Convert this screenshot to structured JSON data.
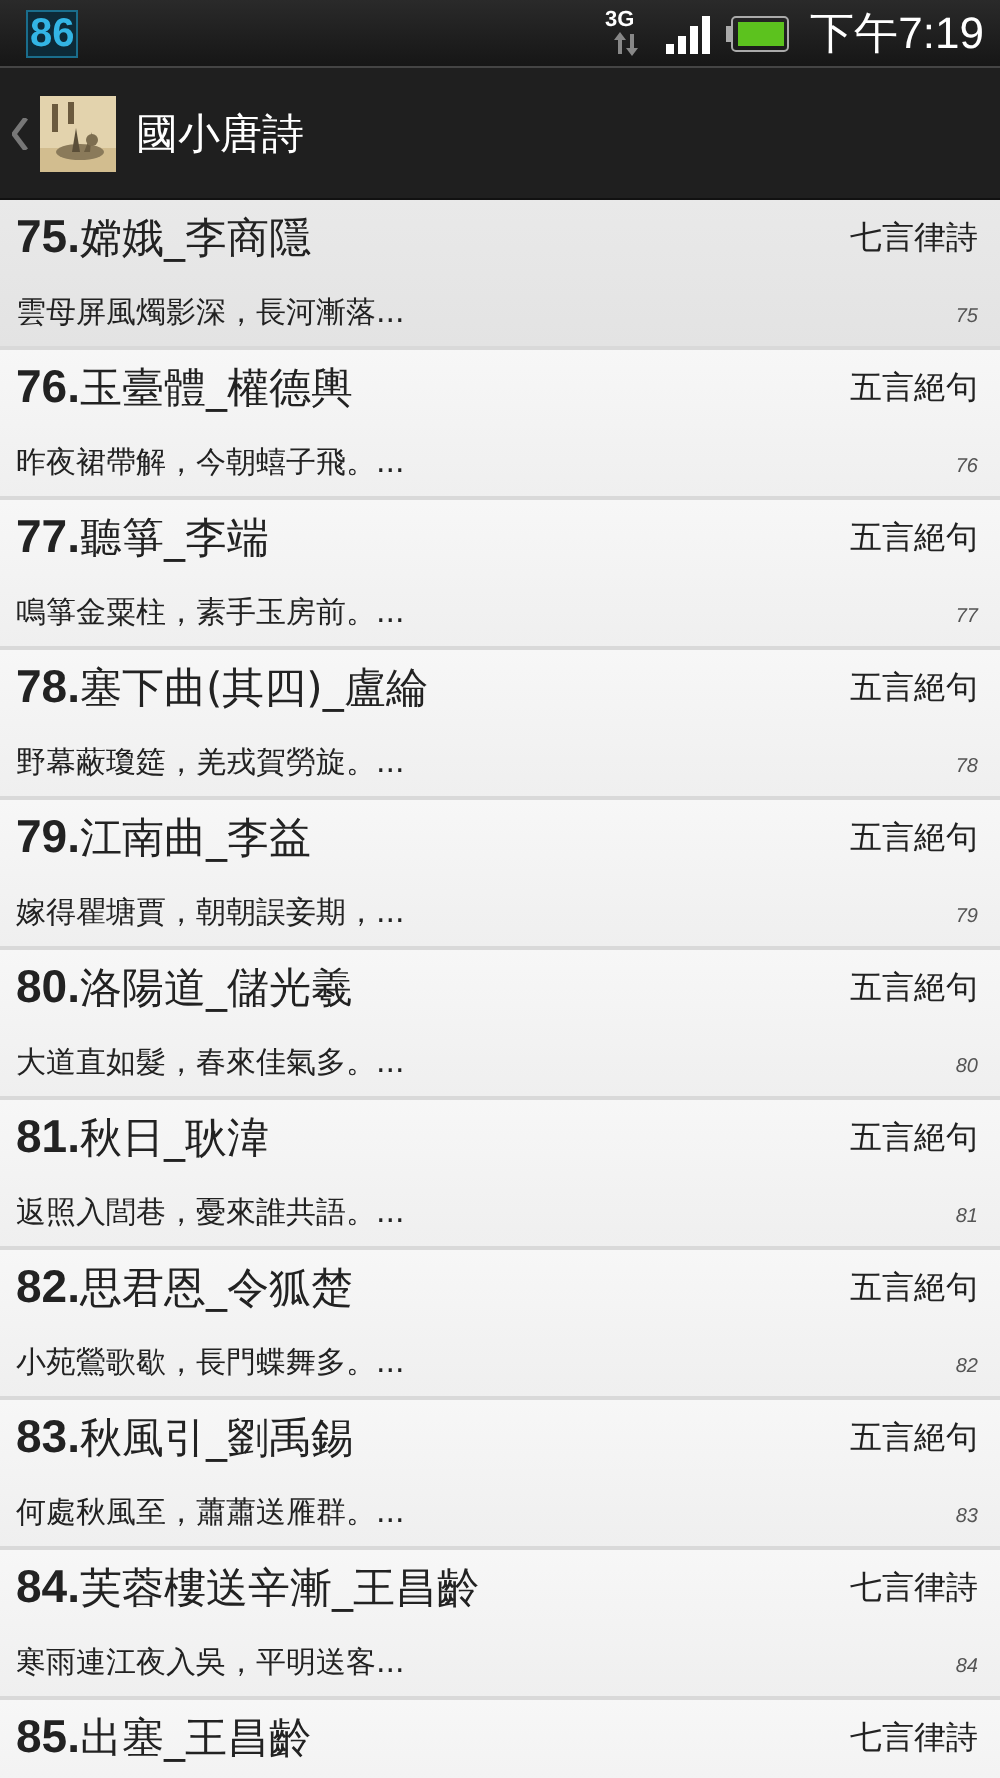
{
  "status_bar": {
    "badge": "86",
    "network": "3G",
    "time": "下午7:19"
  },
  "app_bar": {
    "title": "國小唐詩"
  },
  "poems": [
    {
      "title": "**75.**嫦娥_李商隱",
      "form": "七言律詩",
      "excerpt": "雲母屏風燭影深，長河漸落...",
      "index": "75",
      "selected": true
    },
    {
      "title": "**76.**玉臺體_權德輿",
      "form": "五言絕句",
      "excerpt": "昨夜裙帶解，今朝蟢子飛。...",
      "index": "76",
      "selected": false
    },
    {
      "title": "**77.**聽箏_李端",
      "form": "五言絕句",
      "excerpt": "鳴箏金粟柱，素手玉房前。...",
      "index": "77",
      "selected": false
    },
    {
      "title": "**78.**塞下曲(其四)_盧綸",
      "form": "五言絕句",
      "excerpt": "野幕蔽瓊筵，羌戎賀勞旋。...",
      "index": "78",
      "selected": false
    },
    {
      "title": "**79.**江南曲_李益",
      "form": "五言絕句",
      "excerpt": "嫁得瞿塘賈，朝朝誤妾期，...",
      "index": "79",
      "selected": false
    },
    {
      "title": "**80.**洛陽道_儲光羲",
      "form": "五言絕句",
      "excerpt": "大道直如髮，春來佳氣多。...",
      "index": "80",
      "selected": false
    },
    {
      "title": "**81.**秋日_耿湋",
      "form": "五言絕句",
      "excerpt": "返照入閭巷，憂來誰共語。...",
      "index": "81",
      "selected": false
    },
    {
      "title": "**82.**思君恩_令狐楚",
      "form": "五言絕句",
      "excerpt": "小苑鶯歌歇，長門蝶舞多。...",
      "index": "82",
      "selected": false
    },
    {
      "title": "**83.**秋風引_劉禹錫",
      "form": "五言絕句",
      "excerpt": "何處秋風至，蕭蕭送雁群。...",
      "index": "83",
      "selected": false
    },
    {
      "title": "**84.**芙蓉樓送辛漸_王昌齡",
      "form": "七言律詩",
      "excerpt": "寒雨連江夜入吳，平明送客...",
      "index": "84",
      "selected": false
    },
    {
      "title": "**85.**出塞_王昌齡",
      "form": "七言律詩",
      "selected": false
    }
  ]
}
